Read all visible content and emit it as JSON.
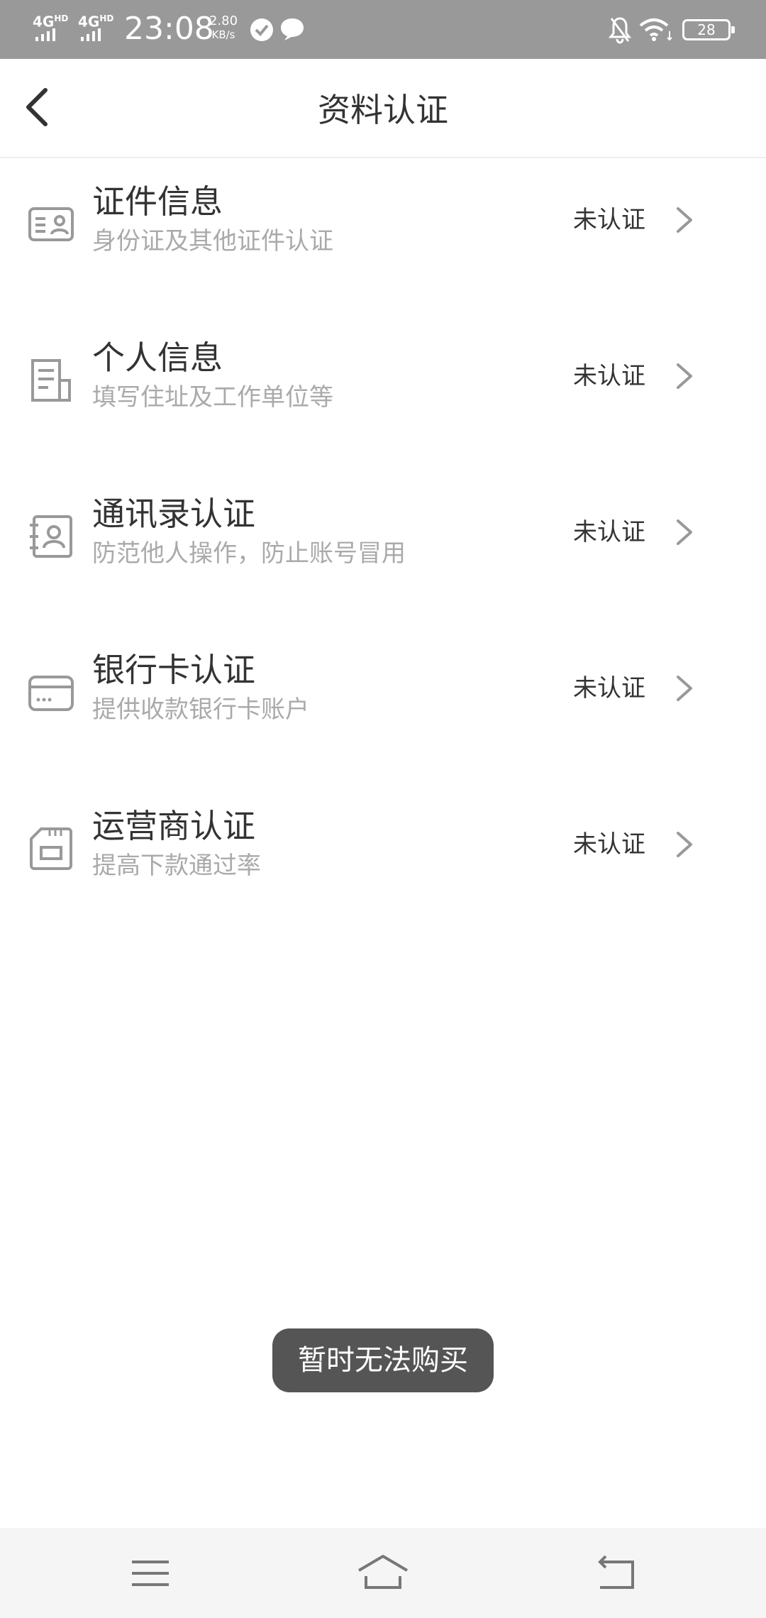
{
  "status_bar": {
    "network_1": "4G",
    "network_1_sup": "HD",
    "network_2": "4G",
    "network_2_sup": "HD",
    "time": "23:08",
    "speed_value": "2.80",
    "speed_unit": "KB/s",
    "battery": "28",
    "icons": [
      "check-circle-icon",
      "chat-bubble-icon",
      "bell-off-icon",
      "wifi-icon",
      "battery-icon"
    ]
  },
  "header": {
    "title": "资料认证",
    "back_icon": "chevron-left-icon"
  },
  "items": [
    {
      "title": "证件信息",
      "subtitle": "身份证及其他证件认证",
      "status": "未认证",
      "icon": "id-card-icon"
    },
    {
      "title": "个人信息",
      "subtitle": "填写住址及工作单位等",
      "status": "未认证",
      "icon": "document-icon"
    },
    {
      "title": "通讯录认证",
      "subtitle": "防范他人操作，防止账号冒用",
      "status": "未认证",
      "icon": "contacts-book-icon"
    },
    {
      "title": "银行卡认证",
      "subtitle": "提供收款银行卡账户",
      "status": "未认证",
      "icon": "bank-card-icon"
    },
    {
      "title": "运营商认证",
      "subtitle": "提高下款通过率",
      "status": "未认证",
      "icon": "sim-card-icon"
    }
  ],
  "toast": {
    "message": "暂时无法购买"
  },
  "nav_bar": {
    "icons": [
      "menu-icon",
      "home-icon",
      "back-icon"
    ]
  },
  "colors": {
    "status_bar_bg": "#999999",
    "text_primary": "#333333",
    "text_secondary": "#aaaaaa",
    "toast_bg": "#555555",
    "nav_bar_bg": "#f5f5f5"
  }
}
